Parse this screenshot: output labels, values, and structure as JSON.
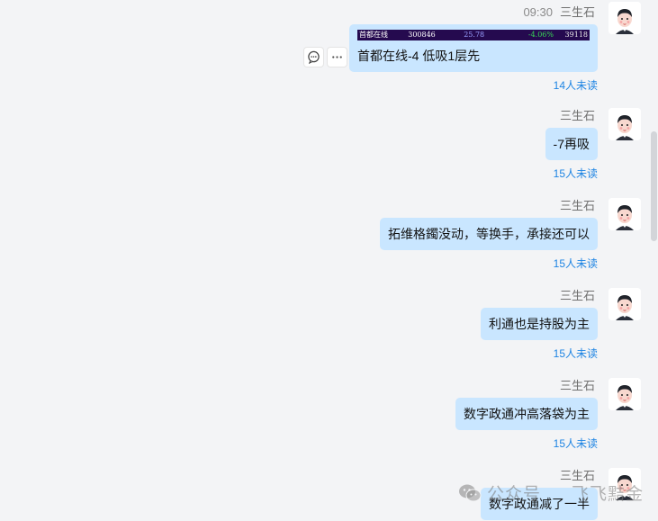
{
  "sender_name": "三生石",
  "messages": [
    {
      "time": "09:30",
      "stock": {
        "name": "首都在线",
        "code": "300846",
        "price": "25.78",
        "change": "-4.06%",
        "volume": "39118"
      },
      "text": "首都在线-4 低吸1层先",
      "read": "14人未读"
    },
    {
      "text": "-7再吸",
      "read": "15人未读"
    },
    {
      "text": "拓维格鐲没动，等换手，承接还可以",
      "read": "15人未读"
    },
    {
      "text": "利通也是持股为主",
      "read": "15人未读"
    },
    {
      "text": "数字政通冲高落袋为主",
      "read": "15人未读"
    },
    {
      "text": "数字政通减了一半"
    }
  ],
  "watermark": {
    "left": "公众号",
    "right": "飞飞黠金"
  },
  "colors": {
    "bubble": "#c9e6ff",
    "read_link": "#1d84e3",
    "background": "#f3f4f6"
  },
  "icons": {
    "comment": "comment-icon",
    "more": "more-icon",
    "avatar": "avatar-icon",
    "wechat": "wechat-icon"
  }
}
